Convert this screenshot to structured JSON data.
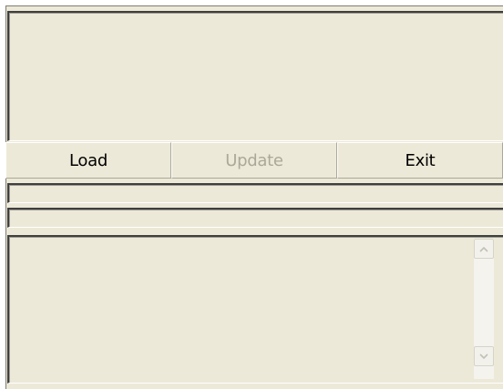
{
  "buttons": {
    "load_label": "Load",
    "update_label": "Update",
    "exit_label": "Exit"
  },
  "state": {
    "update_enabled": false
  },
  "icons": {
    "scroll_up": "chevron-up-icon",
    "scroll_down": "chevron-down-icon"
  },
  "colors": {
    "window_background": "#ece9d8",
    "disabled_text": "#aca899"
  }
}
